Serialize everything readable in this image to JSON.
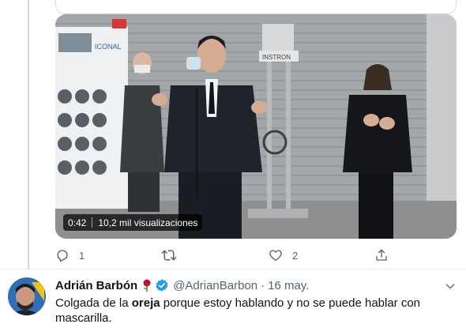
{
  "video": {
    "duration": "0:42",
    "views": "10,2 mil visualizaciones",
    "machine_label": "INSTRON",
    "poster_logo": "ICONAL"
  },
  "actions": {
    "reply_count": "1",
    "retweet_count": "",
    "like_count": "2"
  },
  "tweet": {
    "author_name": "Adrián Barbón",
    "handle": "@AdrianBarbon",
    "separator": "·",
    "date": "16 may.",
    "text_before": "Colgada de la ",
    "text_bold": "oreja",
    "text_after": " porque estoy hablando y no se puede hablar con mascarilla."
  },
  "colors": {
    "verified": "#1d9bf0",
    "rose": "#c8102e",
    "muted_text": "#536471",
    "divider": "#e6ecf0"
  },
  "icons": [
    "reply-icon",
    "retweet-icon",
    "like-icon",
    "share-icon",
    "verified-icon",
    "rose-emoji-icon",
    "chevron-down-icon"
  ]
}
